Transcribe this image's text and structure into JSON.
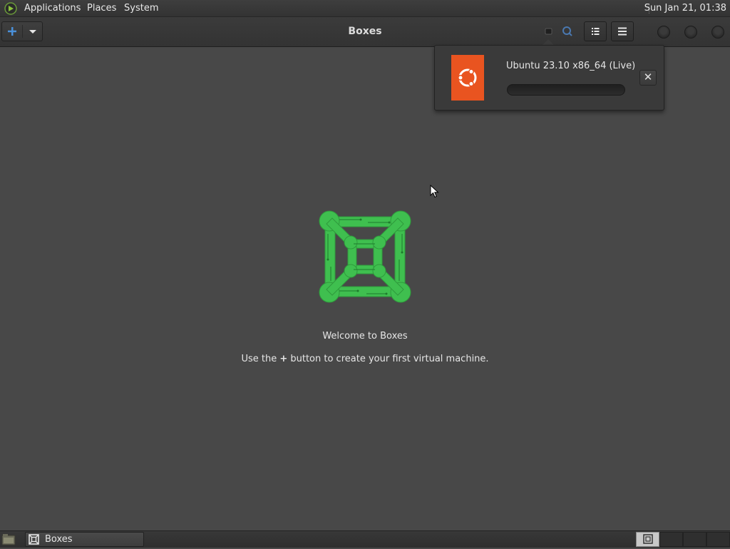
{
  "top_panel": {
    "menus": [
      "Applications",
      "Places",
      "System"
    ],
    "clock": "Sun Jan 21, 01:38"
  },
  "header": {
    "title": "Boxes",
    "icons": {
      "new": "plus-icon",
      "menu_dropdown": "chevron-down-icon",
      "search": "search-icon",
      "view": "list-view-icon",
      "menu": "hamburger-menu-icon"
    }
  },
  "download_popover": {
    "os_name": "Ubuntu 23.10 x86_64 (Live)",
    "progress": 0,
    "close_label": "✕",
    "thumb_color": "#e95420"
  },
  "empty_state": {
    "title": "Welcome to Boxes",
    "hint_prefix": "Use the ",
    "hint_plus": "+",
    "hint_suffix": " button to create your first virtual machine.",
    "logo_color": "#3fbf4f"
  },
  "taskbar": {
    "tasks": [
      {
        "label": "Boxes",
        "icon": "boxes-icon"
      }
    ],
    "workspaces": 4,
    "active_workspace": 0
  },
  "colors": {
    "background": "#484848",
    "accent_blue": "#4a90d9",
    "ubuntu_orange": "#e95420",
    "boxes_green": "#3fbf4f"
  }
}
